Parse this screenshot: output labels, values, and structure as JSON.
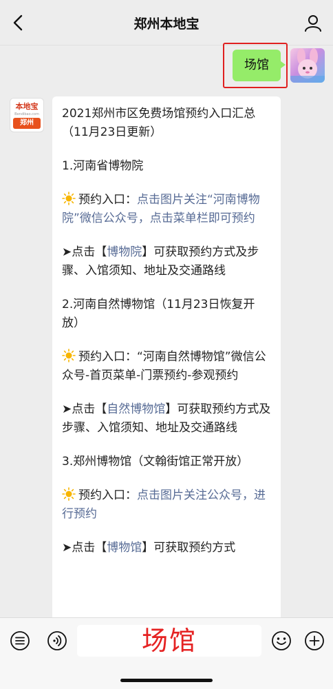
{
  "header": {
    "title": "郑州本地宝",
    "back_icon": "chevron-left-icon",
    "contact_icon": "person-icon"
  },
  "user_message": {
    "text": "场馆",
    "bubble_color": "#95ec69",
    "highlight_color": "#e02020"
  },
  "bot_avatar": {
    "brand": "本地宝",
    "site": "Bendibao.com",
    "city": "郑州"
  },
  "bot_message": {
    "heading": "2021郑州市区免费场馆预约入口汇总（11月23日更新）",
    "venues": [
      {
        "title": "1.河南省博物院",
        "entry_label": "预约入口：",
        "entry_link": "点击图片关注“河南博物院”微信公众号，点击菜单栏即可预约",
        "entry_plain": "",
        "info_prefix": "➤点击【",
        "info_link": "博物院",
        "info_suffix": "】可获取预约方式及步骤、入馆须知、地址及交通路线"
      },
      {
        "title": "2.河南自然博物馆（11月23日恢复开放）",
        "entry_label": "预约入口：",
        "entry_link": "",
        "entry_plain": "“河南自然博物馆”微信公众号-首页菜单-门票预约-参观预约",
        "info_prefix": "➤点击【",
        "info_link": "自然博物馆",
        "info_suffix": "】可获取预约方式及步骤、入馆须知、地址及交通路线"
      },
      {
        "title": "3.郑州博物馆（文翰街馆正常开放）",
        "entry_label": "预约入口：",
        "entry_link": "点击图片关注公众号，进行预约",
        "entry_plain": "",
        "info_prefix": "➤点击【",
        "info_link": "博物馆",
        "info_suffix": "】可获取预约方式"
      }
    ],
    "link_color": "#576b95"
  },
  "input_bar": {
    "text": "场馆",
    "text_color": "#e52222",
    "left_icons": [
      "menu-icon",
      "voice-icon"
    ],
    "right_icons": [
      "emoji-icon",
      "plus-icon"
    ]
  }
}
